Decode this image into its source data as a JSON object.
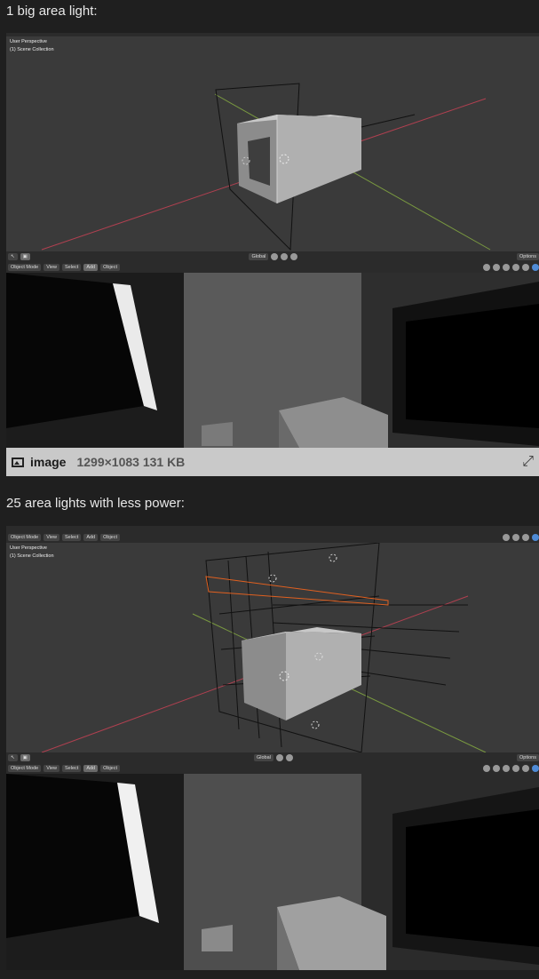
{
  "captions": {
    "first": "1 big area light:",
    "second": "25 area lights with less power:"
  },
  "blender": {
    "mode": "Object Mode",
    "menu_view": "View",
    "menu_select": "Select",
    "menu_add": "Add",
    "menu_object": "Object",
    "orientation": "Global",
    "options": "Options",
    "perspective": "User Perspective",
    "collection": "(1) Scene Collection"
  },
  "image_attachment": {
    "name": "image",
    "meta": "1299×1083 131 KB",
    "icons": [
      "image-icon",
      "expand-icon"
    ]
  },
  "colors": {
    "page_bg": "#1f1f1f",
    "viewport_bg": "#3a3a3a",
    "x_axis": "#b04050",
    "y_axis": "#7a9a40",
    "selected_light": "#e06020"
  }
}
